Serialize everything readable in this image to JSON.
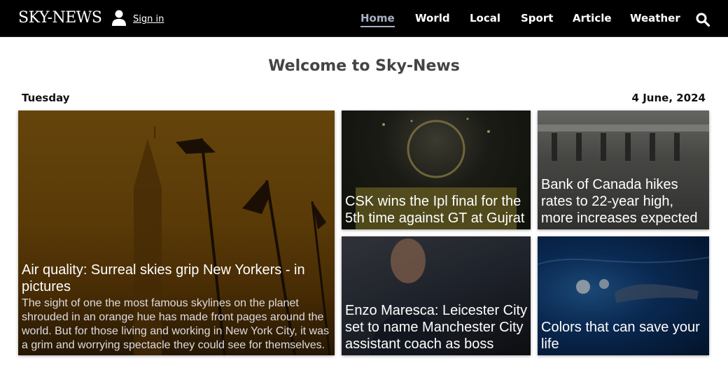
{
  "header": {
    "logo": "SKY-NEWS",
    "signin": "Sign in",
    "nav": [
      {
        "label": "Home",
        "active": true
      },
      {
        "label": "World",
        "active": false
      },
      {
        "label": "Local",
        "active": false
      },
      {
        "label": "Sport",
        "active": false
      },
      {
        "label": "Article",
        "active": false
      },
      {
        "label": "Weather",
        "active": false
      }
    ],
    "icons": {
      "user": "user-icon",
      "search": "search-icon"
    }
  },
  "main": {
    "welcome": "Welcome to Sky-News",
    "day": "Tuesday",
    "date": "4 June, 2024"
  },
  "cards": [
    {
      "title": "Air quality: Surreal skies grip New Yorkers - in pictures",
      "desc": "The sight of one the most famous skylines on the planet shrouded in an orange hue has made front pages around the world. But for those living and working in New York City, it was a grim and worrying spectacle they could see for themselves."
    },
    {
      "title": "CSK wins the Ipl final for the 5th time against GT at Gujrat"
    },
    {
      "title": "Bank of Canada hikes rates to 22-year high, more increases expected"
    },
    {
      "title": "Enzo Maresca: Leicester City set to name Manchester City assistant coach as boss"
    },
    {
      "title": "Colors that can save your life"
    }
  ],
  "colors": {
    "header_bg": "#000000",
    "active_nav": "#a7b0c3",
    "welcome_text": "#444444"
  }
}
